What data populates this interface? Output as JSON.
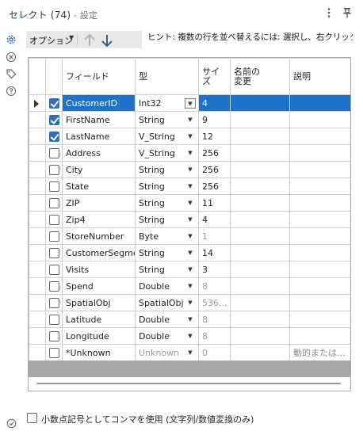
{
  "window": {
    "title": "セレクト (74)",
    "subtitle": " - 設定"
  },
  "toolbar": {
    "options_label": "オプション",
    "hint": "ヒント: 複数の行を並べ替えるには: 選択し、右クリックし"
  },
  "grid": {
    "columns": {
      "field": "フィールド",
      "type": "型",
      "size_line1": "サイ",
      "size_line2": "ズ",
      "rename_line1": "名前の",
      "rename_line2": "変更",
      "description": "説明"
    },
    "rows": [
      {
        "field": "CustomerID",
        "type": "Int32",
        "size": "4",
        "rename": "",
        "description": "",
        "checked": true,
        "selected": true
      },
      {
        "field": "FirstName",
        "type": "String",
        "size": "9",
        "rename": "",
        "description": "",
        "checked": true
      },
      {
        "field": "LastName",
        "type": "V_String",
        "size": "12",
        "rename": "",
        "description": "",
        "checked": true
      },
      {
        "field": "Address",
        "type": "V_String",
        "size": "256",
        "rename": "",
        "description": "",
        "checked": false
      },
      {
        "field": "City",
        "type": "String",
        "size": "256",
        "rename": "",
        "description": "",
        "checked": false
      },
      {
        "field": "State",
        "type": "String",
        "size": "256",
        "rename": "",
        "description": "",
        "checked": false
      },
      {
        "field": "ZIP",
        "type": "String",
        "size": "11",
        "rename": "",
        "description": "",
        "checked": false
      },
      {
        "field": "Zip4",
        "type": "String",
        "size": "4",
        "rename": "",
        "description": "",
        "checked": false
      },
      {
        "field": "StoreNumber",
        "type": "Byte",
        "size": "1",
        "rename": "",
        "description": "",
        "checked": false,
        "size_muted": true
      },
      {
        "field": "CustomerSegment",
        "type": "String",
        "size": "14",
        "rename": "",
        "description": "",
        "checked": false
      },
      {
        "field": "Visits",
        "type": "String",
        "size": "3",
        "rename": "",
        "description": "",
        "checked": false
      },
      {
        "field": "Spend",
        "type": "Double",
        "size": "8",
        "rename": "",
        "description": "",
        "checked": false,
        "size_muted": true
      },
      {
        "field": "SpatialObj",
        "type": "SpatialObj",
        "size": "536...",
        "rename": "",
        "description": "",
        "checked": false,
        "size_muted": true
      },
      {
        "field": "Latitude",
        "type": "Double",
        "size": "8",
        "rename": "",
        "description": "",
        "checked": false,
        "size_muted": true
      },
      {
        "field": "Longitude",
        "type": "Double",
        "size": "8",
        "rename": "",
        "description": "",
        "checked": false,
        "size_muted": true
      },
      {
        "field": "*Unknown",
        "type": "Unknown",
        "size": "0",
        "rename": "",
        "description": "動的または...",
        "checked": false,
        "size_muted": true,
        "type_muted": true
      }
    ]
  },
  "footer": {
    "decimal_comma_label": "小数点記号としてコンマを使用 (文字列/数値変換のみ)"
  },
  "colors": {
    "selection": "#1e72c8",
    "checkbox_on": "#2f6dbf",
    "accent_icon": "#2f6dbf"
  },
  "icons": [
    "settings-gear-icon",
    "variable-x-icon",
    "tag-icon",
    "help-icon",
    "kebab-menu-icon",
    "pin-icon",
    "move-up-icon",
    "move-down-icon",
    "check-circle-icon"
  ]
}
